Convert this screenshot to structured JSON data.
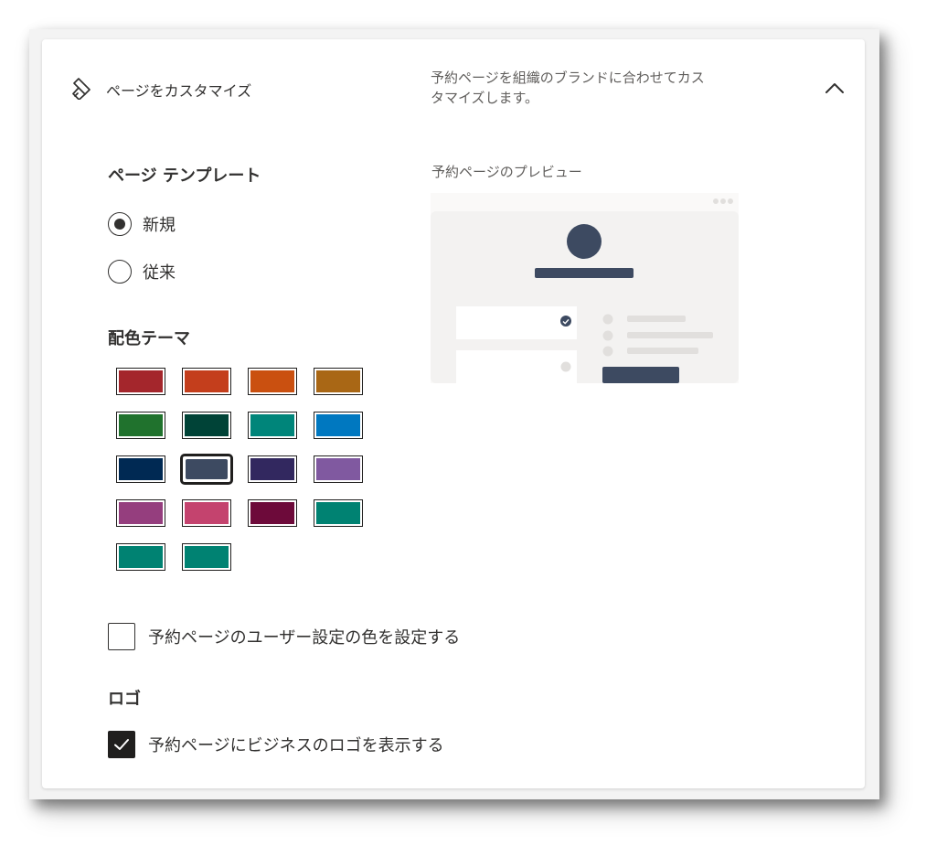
{
  "header": {
    "title": "ページをカスタマイズ",
    "description": "予約ページを組織のブランドに合わせてカスタマイズします。",
    "icon": "paintbrush-icon",
    "collapse_icon": "chevron-up-icon"
  },
  "template": {
    "title": "ページ テンプレート",
    "options": [
      {
        "label": "新規",
        "selected": true
      },
      {
        "label": "従来",
        "selected": false
      }
    ]
  },
  "theme": {
    "title": "配色テーマ",
    "selected_index": 9,
    "colors": [
      "#a4262c",
      "#c43e1c",
      "#ca5010",
      "#a96715",
      "#20722d",
      "#004337",
      "#00857a",
      "#0078c0",
      "#002953",
      "#3d4a61",
      "#32285f",
      "#8059a0",
      "#953e7e",
      "#c4436e",
      "#6d0a3a",
      "#008272",
      "#008272",
      "#008272"
    ]
  },
  "preview": {
    "label": "予約ページのプレビュー",
    "accent_color": "#3d4a61"
  },
  "custom_color": {
    "label": "予約ページのユーザー設定の色を設定する",
    "checked": false
  },
  "logo": {
    "title": "ロゴ",
    "show_logo_label": "予約ページにビジネスのロゴを表示する",
    "checked": true
  }
}
